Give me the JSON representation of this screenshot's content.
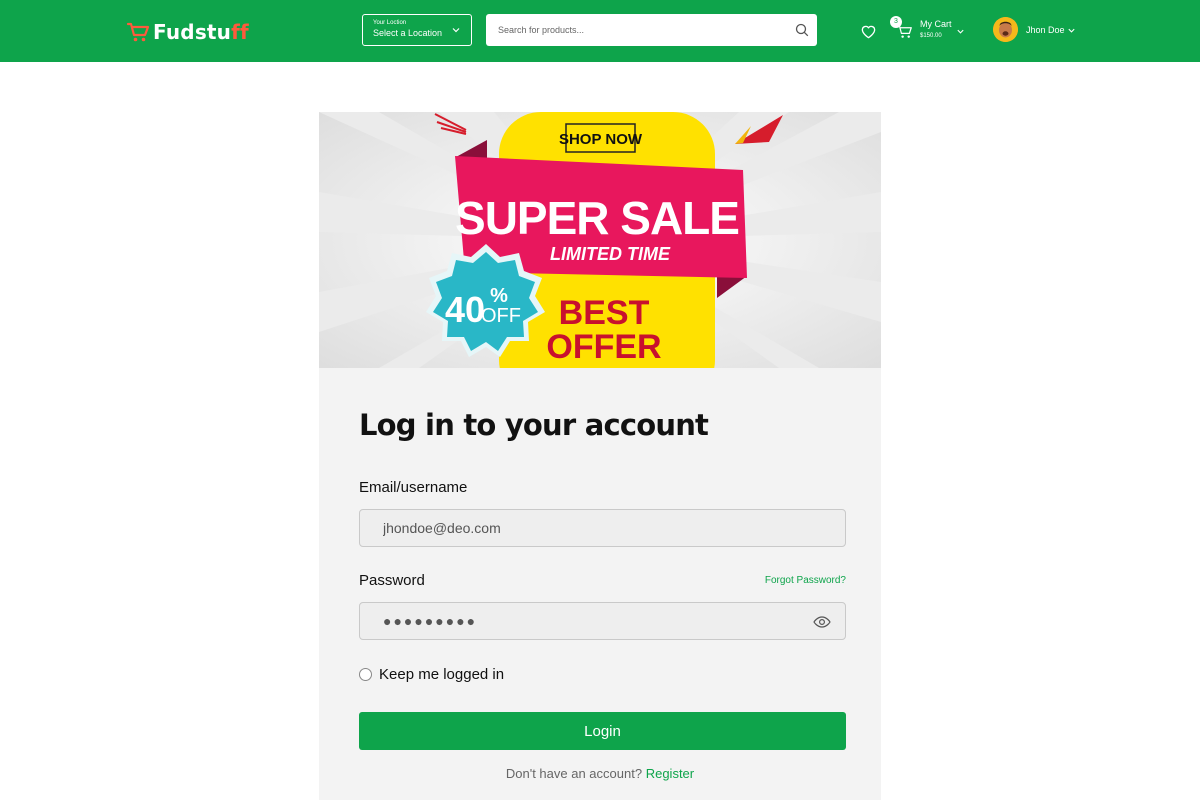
{
  "header": {
    "logo": {
      "part1": "Fudstu",
      "part2": "ff"
    },
    "location": {
      "label": "Your Loction",
      "value": "Select a Location"
    },
    "search": {
      "placeholder": "Search for products..."
    },
    "cart": {
      "count": "3",
      "label": "My Cart",
      "total": "$150.00"
    },
    "user": {
      "name": "Jhon Doe"
    }
  },
  "banner": {
    "shop_now": "SHOP NOW",
    "headline": "SUPER SALE",
    "subline": "LIMITED TIME",
    "discount_number": "40",
    "discount_percent": "%",
    "discount_off": "OFF",
    "offer_line1": "BEST",
    "offer_line2": "OFFER"
  },
  "login": {
    "title": "Log in to your account",
    "email_label": "Email/username",
    "email_value": "jhondoe@deo.com",
    "password_label": "Password",
    "password_value": "●●●●●●●●●",
    "forgot_label": "Forgot Password?",
    "keep_label": "Keep me logged in",
    "button_label": "Login",
    "register_prompt": "Don't have an account?",
    "register_label": "Register"
  },
  "colors": {
    "brand_green": "#0ea44b",
    "banner_pink": "#e8175d",
    "banner_yellow": "#ffe100",
    "badge_teal": "#29b7c7",
    "offer_red": "#c8102e"
  }
}
